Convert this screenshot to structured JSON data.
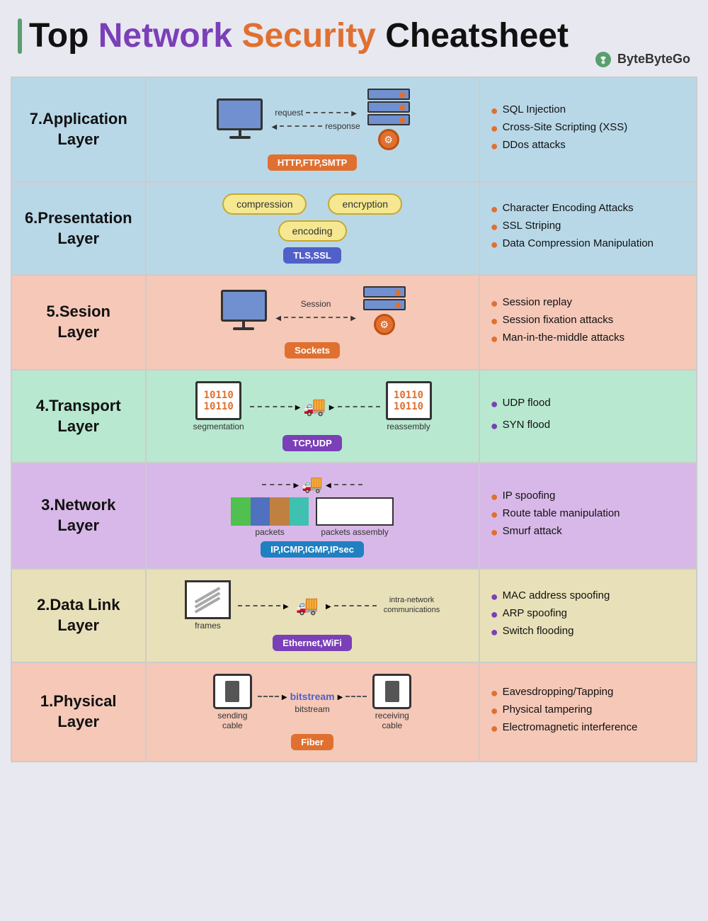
{
  "header": {
    "title_start": "Top ",
    "title_network": "Network",
    "title_space": " ",
    "title_security": "Security",
    "title_end": " Cheatsheet",
    "brand": "ByteByteGo"
  },
  "layers": [
    {
      "id": 7,
      "label": "7.Application\nLayer",
      "label_line1": "7.Application",
      "label_line2": "Layer",
      "protocol": "HTTP,FTP,SMTP",
      "protocol_color": "badge-orange",
      "color_class": "layer-7",
      "bullet_color": "bullet-orange",
      "attacks": [
        "SQL Injection",
        "Cross-Site Scripting (XSS)",
        "DDos attacks"
      ],
      "diagram_type": "layer7"
    },
    {
      "id": 6,
      "label_line1": "6.Presentation",
      "label_line2": "Layer",
      "protocol": "TLS,SSL",
      "protocol_color": "badge-blue",
      "color_class": "layer-6",
      "bullet_color": "bullet-orange",
      "attacks": [
        "Character Encoding Attacks",
        "SSL Striping",
        "Data Compression Manipulation"
      ],
      "diagram_type": "layer6",
      "ovals": [
        "compression",
        "encryption",
        "encoding"
      ]
    },
    {
      "id": 5,
      "label_line1": "5.Sesion",
      "label_line2": "Layer",
      "protocol": "Sockets",
      "protocol_color": "badge-orange",
      "color_class": "layer-5",
      "bullet_color": "bullet-orange",
      "attacks": [
        "Session replay",
        "Session fixation attacks",
        "Man-in-the-middle attacks"
      ],
      "diagram_type": "layer5"
    },
    {
      "id": 4,
      "label_line1": "4.Transport",
      "label_line2": "Layer",
      "protocol": "TCP,UDP",
      "protocol_color": "badge-purple",
      "color_class": "layer-4",
      "bullet_color": "bullet-purple",
      "attacks": [
        "UDP flood",
        "SYN flood"
      ],
      "diagram_type": "layer4"
    },
    {
      "id": 3,
      "label_line1": "3.Network",
      "label_line2": "Layer",
      "protocol": "IP,ICMP,IGMP,IPsec",
      "protocol_color": "badge-teal",
      "color_class": "layer-3",
      "bullet_color": "bullet-orange",
      "attacks": [
        "IP spoofing",
        "Route table manipulation",
        "Smurf attack"
      ],
      "diagram_type": "layer3"
    },
    {
      "id": 2,
      "label_line1": "2.Data Link",
      "label_line2": "Layer",
      "protocol": "Ethernet,WiFi",
      "protocol_color": "badge-purple",
      "color_class": "layer-2",
      "bullet_color": "bullet-purple",
      "attacks": [
        "MAC address spoofing",
        "ARP spoofing",
        "Switch flooding"
      ],
      "diagram_type": "layer2"
    },
    {
      "id": 1,
      "label_line1": "1.Physical",
      "label_line2": "Layer",
      "protocol": "Fiber",
      "protocol_color": "badge-orange",
      "color_class": "layer-1",
      "bullet_color": "bullet-orange",
      "attacks": [
        "Eavesdropping/Tapping",
        "Physical tampering",
        "Electromagnetic interference"
      ],
      "diagram_type": "layer1"
    }
  ],
  "labels": {
    "request": "request",
    "response": "response",
    "session": "Session",
    "segmentation": "segmentation",
    "reassembly": "reassembly",
    "packets": "packets",
    "packets_assembly": "packets assembly",
    "frames": "frames",
    "intra_network": "intra-network\ncommunications",
    "sending_cable": "sending\ncable",
    "bitstream": "bitstream",
    "receiving_cable": "receiving\ncable"
  }
}
